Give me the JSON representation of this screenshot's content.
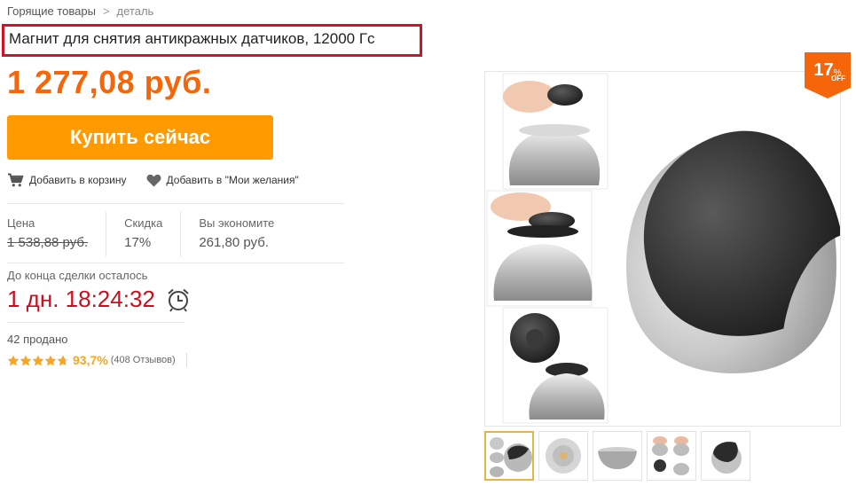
{
  "breadcrumb": {
    "parent": "Горящие товары",
    "separator": ">",
    "current": "деталь"
  },
  "product": {
    "title": "Магнит для снятия антикражных датчиков, 12000 Гс",
    "price": "1 277,08 руб."
  },
  "actions": {
    "buy_now": "Купить сейчас",
    "add_to_cart": "Добавить в корзину",
    "add_to_wishlist": "Добавить в \"Мои желания\""
  },
  "stats": {
    "price_label": "Цена",
    "price_value": "1 538,88 руб.",
    "discount_label": "Скидка",
    "discount_value": "17%",
    "savings_label": "Вы экономите",
    "savings_value": "261,80 руб."
  },
  "deal": {
    "label": "До конца сделки осталось",
    "time_left": "1 дн. 18:24:32"
  },
  "sales": {
    "sold": "42 продано",
    "rating_stars": 4.7,
    "rating_percent": "93,7%",
    "reviews": "(408 Отзывов)"
  },
  "badge": {
    "number": "17",
    "percent": "%",
    "off": "OFF"
  },
  "gallery": {
    "thumbnail_count": 5,
    "selected_index": 0
  },
  "colors": {
    "accent_orange": "#ff9a00",
    "price_orange": "#f5660a",
    "timer_red": "#c7101f",
    "highlight_border": "#d2112a",
    "star_gold": "#f5a623"
  }
}
